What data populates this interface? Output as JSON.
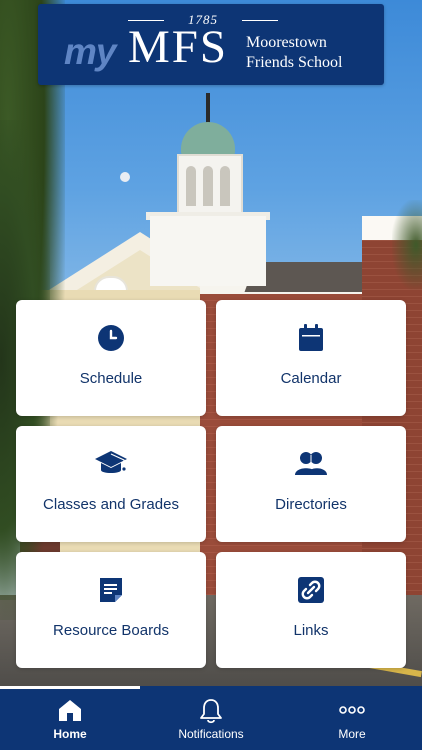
{
  "header": {
    "year": "1785",
    "brand_prefix": "my",
    "brand_initials": "MFS",
    "school_name_line1": "Moorestown",
    "school_name_line2": "Friends School"
  },
  "tiles": [
    {
      "label": "Schedule",
      "icon": "clock-icon"
    },
    {
      "label": "Calendar",
      "icon": "calendar-icon"
    },
    {
      "label": "Classes and Grades",
      "icon": "graduation-cap-icon"
    },
    {
      "label": "Directories",
      "icon": "people-icon"
    },
    {
      "label": "Resource Boards",
      "icon": "note-icon"
    },
    {
      "label": "Links",
      "icon": "link-icon"
    }
  ],
  "tabbar": {
    "tabs": [
      {
        "label": "Home",
        "icon": "home-icon",
        "active": true
      },
      {
        "label": "Notifications",
        "icon": "bell-icon",
        "active": false
      },
      {
        "label": "More",
        "icon": "more-icon",
        "active": false
      }
    ]
  },
  "colors": {
    "brand_navy": "#0d3575",
    "tile_text": "#12346a",
    "brand_light_blue": "#5f85c4"
  }
}
